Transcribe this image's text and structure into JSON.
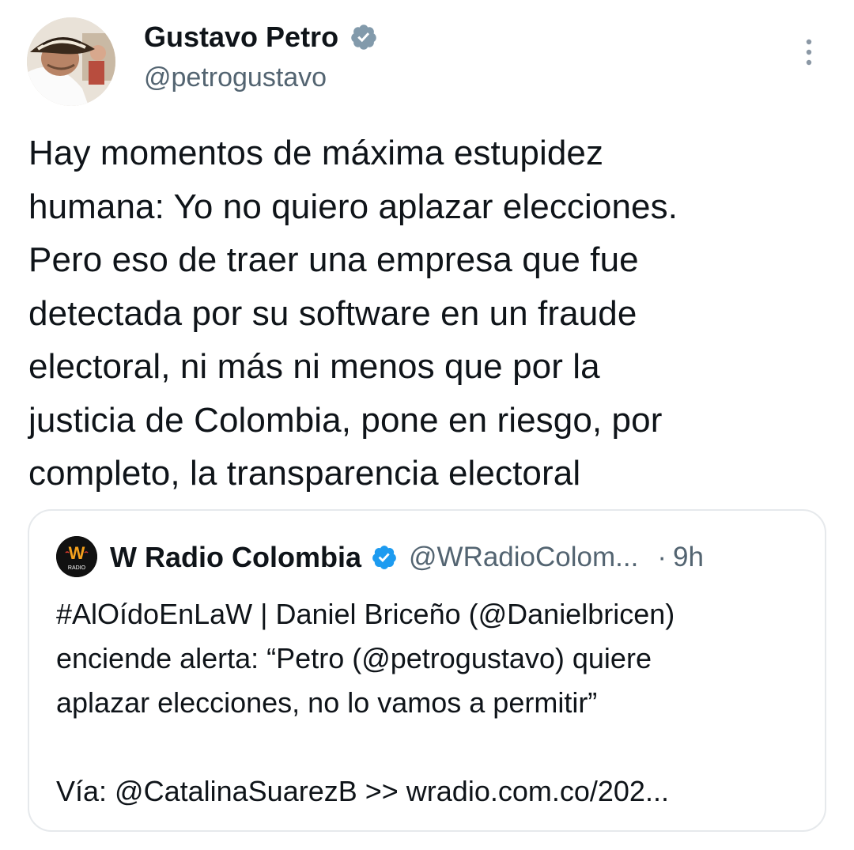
{
  "tweet": {
    "author": {
      "name": "Gustavo Petro",
      "handle": "@petrogustavo",
      "verified": true
    },
    "text": "Hay momentos de máxima estupidez\nhumana: Yo no quiero aplazar elecciones.\nPero eso de traer una empresa que fue\ndetectada por su software en un fraude\nelectoral, ni más ni menos que por la\njusticia de Colombia, pone en riesgo, por\ncompleto, la transparencia electoral",
    "more_icon": "more-vertical-icon"
  },
  "quote": {
    "author": {
      "name": "W Radio Colombia",
      "handle": "@WRadioColom...",
      "verified": true,
      "avatar_text": "W",
      "avatar_subtext": "RADIO"
    },
    "separator": "·",
    "time": "9h",
    "text": "#AlOídoEnLaW | Daniel Briceño (@Danielbricen)\nenciende alerta: “Petro (@petrogustavo) quiere\naplazar elecciones, no lo vamos a permitir”\n\nVía: @CatalinaSuarezB >> wradio.com.co/202..."
  },
  "colors": {
    "verified_badge": "#829aab",
    "quote_verified_badge": "#1d9bf0",
    "secondary_text": "#536471",
    "primary_text": "#0f1419",
    "card_border": "#e6e9ec"
  }
}
